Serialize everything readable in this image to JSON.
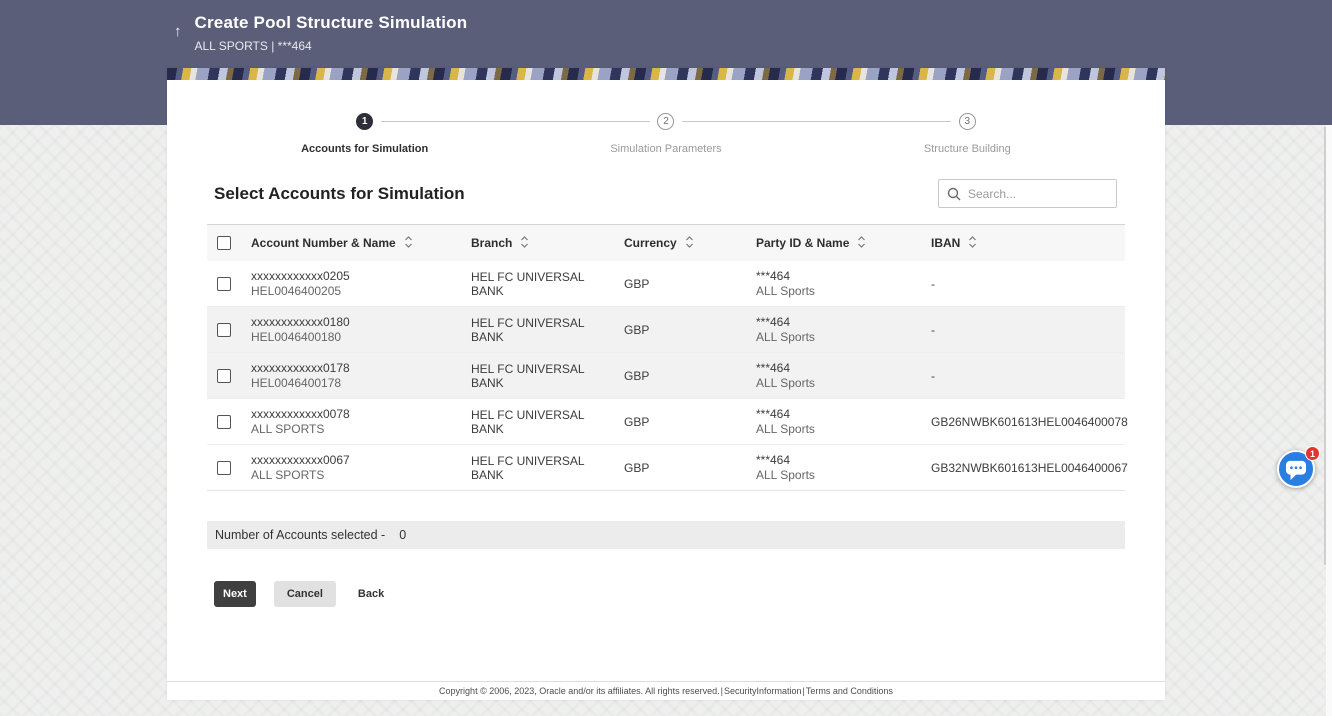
{
  "header": {
    "title": "Create Pool Structure Simulation",
    "subtitle": "ALL SPORTS | ***464",
    "up_arrow": "↑"
  },
  "stepper": {
    "steps": [
      {
        "number": "1",
        "label": "Accounts for Simulation"
      },
      {
        "number": "2",
        "label": "Simulation Parameters"
      },
      {
        "number": "3",
        "label": "Structure Building"
      }
    ]
  },
  "content": {
    "section_title": "Select Accounts for Simulation",
    "search_placeholder": "Search..."
  },
  "table": {
    "columns": [
      "Account Number & Name",
      "Branch",
      "Currency",
      "Party ID & Name",
      "IBAN"
    ],
    "rows": [
      {
        "account1": "xxxxxxxxxxxx0205",
        "account2": "HEL0046400205",
        "branch": "HEL FC UNIVERSAL BANK",
        "currency": "GBP",
        "party1": "***464",
        "party2": "ALL Sports",
        "iban": "-"
      },
      {
        "account1": "xxxxxxxxxxxx0180",
        "account2": "HEL0046400180",
        "branch": "HEL FC UNIVERSAL BANK",
        "currency": "GBP",
        "party1": "***464",
        "party2": "ALL Sports",
        "iban": "-"
      },
      {
        "account1": "xxxxxxxxxxxx0178",
        "account2": "HEL0046400178",
        "branch": "HEL FC UNIVERSAL BANK",
        "currency": "GBP",
        "party1": "***464",
        "party2": "ALL Sports",
        "iban": "-"
      },
      {
        "account1": "xxxxxxxxxxxx0078",
        "account2": "ALL SPORTS",
        "branch": "HEL FC UNIVERSAL BANK",
        "currency": "GBP",
        "party1": "***464",
        "party2": "ALL Sports",
        "iban": "GB26NWBK601613HEL0046400078"
      },
      {
        "account1": "xxxxxxxxxxxx0067",
        "account2": "ALL SPORTS",
        "branch": "HEL FC UNIVERSAL BANK",
        "currency": "GBP",
        "party1": "***464",
        "party2": "ALL Sports",
        "iban": "GB32NWBK601613HEL0046400067"
      }
    ]
  },
  "summary": {
    "label": "Number of Accounts selected -",
    "count": "0"
  },
  "actions": {
    "next": "Next",
    "cancel": "Cancel",
    "back": "Back"
  },
  "footer": {
    "text": "Copyright © 2006, 2023, Oracle and/or its affiliates. All rights reserved.",
    "sep": "|",
    "links": [
      "SecurityInformation",
      "Terms and Conditions"
    ]
  },
  "chat": {
    "badge": "1"
  }
}
